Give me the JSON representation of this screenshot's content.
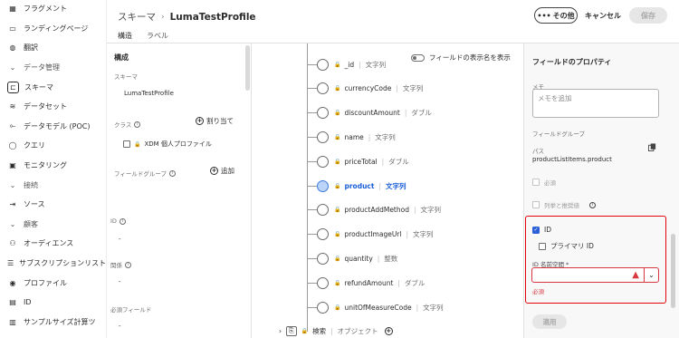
{
  "nav": {
    "items": [
      {
        "label": "フラグメント",
        "icon": "fragment-icon",
        "section": false
      },
      {
        "label": "ランディングページ",
        "icon": "landing-page-icon",
        "section": false
      },
      {
        "label": "翻訳",
        "icon": "globe-icon",
        "section": false
      },
      {
        "label": "データ管理",
        "icon": "chevron-down-icon",
        "section": true
      },
      {
        "label": "スキーマ",
        "icon": "schema-icon",
        "section": false,
        "active": true
      },
      {
        "label": "データセット",
        "icon": "dataset-icon",
        "section": false
      },
      {
        "label": "データモデル (POC)",
        "icon": "data-model-icon",
        "section": false
      },
      {
        "label": "クエリ",
        "icon": "query-icon",
        "section": false
      },
      {
        "label": "モニタリング",
        "icon": "monitoring-icon",
        "section": false
      },
      {
        "label": "接続",
        "icon": "chevron-down-icon",
        "section": true
      },
      {
        "label": "ソース",
        "icon": "source-icon",
        "section": false
      },
      {
        "label": "顧客",
        "icon": "chevron-down-icon",
        "section": true
      },
      {
        "label": "オーディエンス",
        "icon": "audience-icon",
        "section": false
      },
      {
        "label": "サブスクリプションリスト",
        "icon": "subscription-list-icon",
        "section": false
      },
      {
        "label": "プロファイル",
        "icon": "profile-icon",
        "section": false
      },
      {
        "label": "ID",
        "icon": "identity-icon",
        "section": false
      },
      {
        "label": "サンプルサイズ計算ツ",
        "icon": "calculator-icon",
        "section": false
      }
    ]
  },
  "header": {
    "breadcrumb_parent": "スキーマ",
    "breadcrumb_sep": "›",
    "breadcrumb_current": "LumaTestProfile",
    "tabs": [
      {
        "label": "構造",
        "active": true
      },
      {
        "label": "ラベル",
        "active": false
      }
    ],
    "more_label": "その他",
    "cancel_label": "キャンセル",
    "save_label": "保存"
  },
  "composition": {
    "title": "構成",
    "schema_label": "スキーマ",
    "schema_value": "LumaTestProfile",
    "class_label": "クラス",
    "assign_label": "割り当て",
    "class_value": "XDM 個人プロファイル",
    "fieldgroup_label": "フィールドグループ",
    "add_label": "追加",
    "id_label": "ID",
    "id_value": "-",
    "relation_label": "関係",
    "relation_value": "-",
    "required_label": "必須フィールド",
    "required_value": "-"
  },
  "tree": {
    "toggle_label": "フィールドの表示名を表示",
    "fields": [
      {
        "name": "_id",
        "type": "文字列"
      },
      {
        "name": "currencyCode",
        "type": "文字列"
      },
      {
        "name": "discountAmount",
        "type": "ダブル"
      },
      {
        "name": "name",
        "type": "文字列"
      },
      {
        "name": "priceTotal",
        "type": "ダブル"
      },
      {
        "name": "product",
        "type": "文字列",
        "selected": true
      },
      {
        "name": "productAddMethod",
        "type": "文字列"
      },
      {
        "name": "productImageUrl",
        "type": "文字列"
      },
      {
        "name": "quantity",
        "type": "整数"
      },
      {
        "name": "refundAmount",
        "type": "ダブル"
      },
      {
        "name": "unitOfMeasureCode",
        "type": "文字列"
      }
    ],
    "bottom_name": "検索",
    "bottom_type": "オブジェクト"
  },
  "props": {
    "title": "フィールドのプロパティ",
    "memo_label": "メモ",
    "memo_placeholder": "メモを追加",
    "fieldgroup_label": "フィールドグループ",
    "path_label": "パス",
    "path_value": "productListItems.product",
    "required_label": "必須",
    "enum_label": "列挙と推奨値",
    "identity_label": "ID",
    "primary_label": "プライマリ ID",
    "namespace_label": "ID 名前空間 *",
    "error_label": "必須",
    "apply_label": "適用"
  },
  "colors": {
    "accent": "#2c60d6",
    "selected_field": "#1b5fd6",
    "error": "#d7373f",
    "highlight_border": "#e2000b"
  }
}
